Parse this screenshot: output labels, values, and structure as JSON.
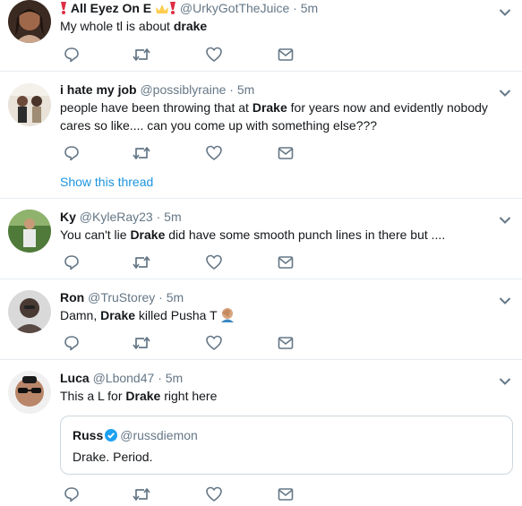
{
  "tweets": [
    {
      "name": "All Eyez On E",
      "handle": "@UrkyGotTheJuice",
      "dot": "·",
      "time": "5m",
      "text_pre": "My whole tl is about ",
      "text_bold": "drake",
      "text_post": ""
    },
    {
      "name": "i hate my job",
      "handle": "@possiblyraine",
      "dot": "·",
      "time": "5m",
      "text_pre": "people have been throwing that at ",
      "text_bold": "Drake",
      "text_post": " for years now and evidently nobody cares so like.... can you come up with something else???",
      "show_thread": "Show this thread"
    },
    {
      "name": "Ky",
      "handle": "@KyleRay23",
      "dot": "·",
      "time": "5m",
      "text_pre": "You can't lie ",
      "text_bold": "Drake",
      "text_post": " did have some smooth punch lines in there but ...."
    },
    {
      "name": "Ron",
      "handle": "@TruStorey",
      "dot": "·",
      "time": "5m",
      "text_pre": "Damn, ",
      "text_bold": "Drake",
      "text_post": " killed Pusha T"
    },
    {
      "name": "Luca",
      "handle": "@Lbond47",
      "dot": "·",
      "time": "5m",
      "text_pre": "This a L for ",
      "text_bold": "Drake",
      "text_post": " right here",
      "quote": {
        "name": "Russ",
        "handle": "@russdiemon",
        "text": "Drake. Period."
      }
    }
  ],
  "icons": [
    "reply-icon",
    "retweet-icon",
    "like-icon",
    "message-icon",
    "chevron-down-icon",
    "verified-icon"
  ],
  "colors": {
    "link": "#1c94e0",
    "icon": "#657786",
    "text": "#14171a",
    "divider": "#e6ecf0"
  }
}
